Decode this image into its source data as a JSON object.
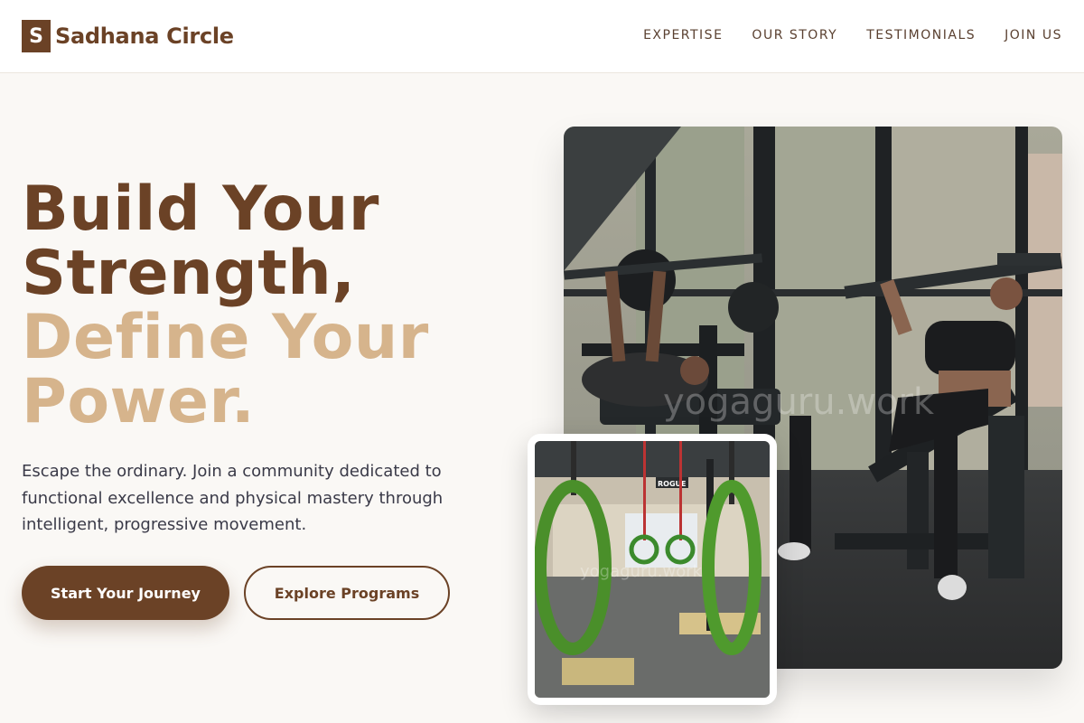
{
  "brand": {
    "mark": "S",
    "name": "Sadhana Circle",
    "color": "#6b4226",
    "accent": "#d6b48c"
  },
  "nav": {
    "items": [
      "EXPERTISE",
      "OUR STORY",
      "TESTIMONIALS",
      "JOIN US"
    ]
  },
  "hero": {
    "headline_dark": [
      "Build Your",
      "Strength,"
    ],
    "headline_light": [
      "Define Your",
      "Power."
    ],
    "subtext": "Escape the ordinary. Join a community dedicated to functional excellence and physical mastery through intelligent, progressive movement.",
    "primary_cta": "Start Your Journey",
    "secondary_cta": "Explore Programs"
  },
  "images": {
    "main_watermark": "yogaguru.work",
    "secondary_watermark": "yogaguru.work",
    "secondary_sign": "ROGUE"
  }
}
